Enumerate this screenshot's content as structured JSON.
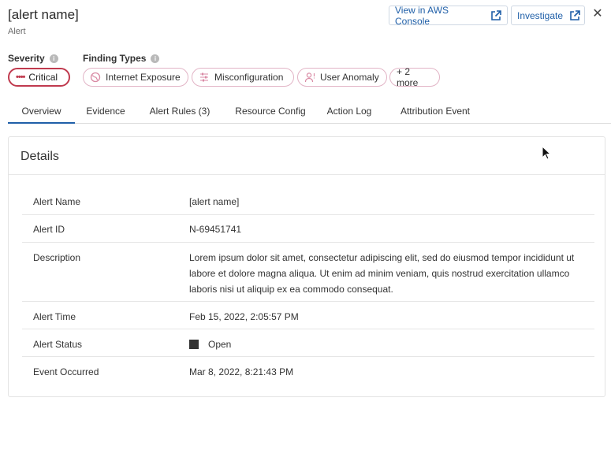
{
  "header": {
    "title": "[alert name]",
    "subtitle": "Alert",
    "aws_button": "View in AWS Console",
    "investigate_button": "Investigate",
    "close_glyph": "✕"
  },
  "severity": {
    "label": "Severity",
    "value": "Critical",
    "dots": "••••",
    "color": "#c03a4e"
  },
  "finding_types": {
    "label": "Finding Types",
    "items": [
      {
        "label": "Internet Exposure",
        "icon": "globe-icon"
      },
      {
        "label": "Misconfiguration",
        "icon": "sliders-icon"
      },
      {
        "label": "User Anomaly",
        "icon": "user-alert-icon"
      }
    ],
    "more": "+ 2 more"
  },
  "tabs": [
    {
      "label": "Overview",
      "active": true
    },
    {
      "label": "Evidence"
    },
    {
      "label": "Alert Rules (3)"
    },
    {
      "label": "Resource Config"
    },
    {
      "label": "Action Log"
    },
    {
      "label": "Attribution Event"
    }
  ],
  "details": {
    "title": "Details",
    "rows": [
      {
        "key": "Alert Name",
        "value": "[alert name]"
      },
      {
        "key": "Alert ID",
        "value": "N-69451741"
      },
      {
        "key": "Description",
        "value": "Lorem ipsum dolor sit amet, consectetur adipiscing elit, sed do eiusmod tempor incididunt ut labore et dolore magna aliqua. Ut enim ad minim veniam, quis nostrud exercitation ullamco laboris nisi ut aliquip ex ea commodo consequat."
      },
      {
        "key": "Alert Time",
        "value": "Feb 15, 2022, 2:05:57 PM"
      },
      {
        "key": "Alert Status",
        "value": "Open"
      },
      {
        "key": "Event Occurred",
        "value": "Mar 8, 2022, 8:21:43 PM"
      }
    ]
  },
  "colors": {
    "accent": "#1f5fa8",
    "chip_border": "#e2b4c6"
  }
}
